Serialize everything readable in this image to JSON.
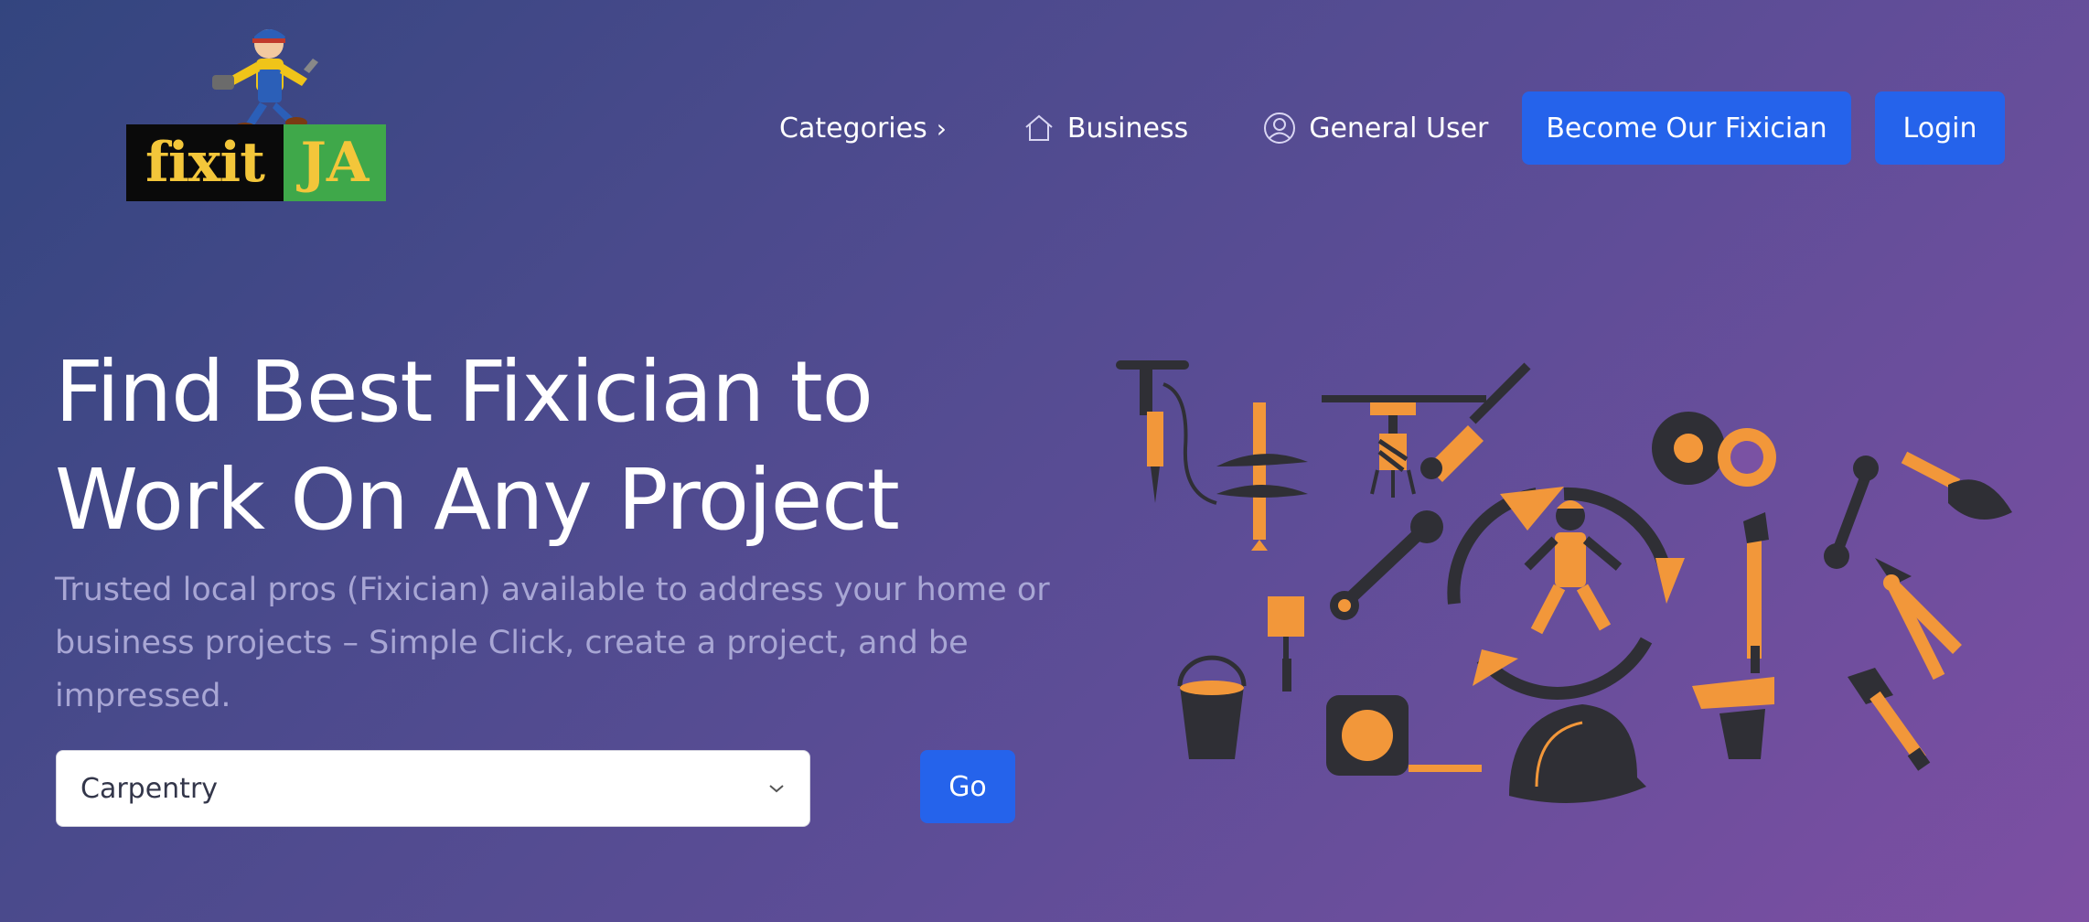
{
  "brand": {
    "logo_text_left": "fixit",
    "logo_text_right": "JA",
    "logo_colors": {
      "dark": "#0a0a0a",
      "green": "#3fa84a",
      "yellow": "#f3c63a"
    }
  },
  "nav": {
    "categories_label": "Categories",
    "categories_chevron": "›",
    "business_label": "Business",
    "business_icon": "home-icon",
    "general_user_label": "General User",
    "general_user_icon": "user-circle-icon"
  },
  "actions": {
    "become_label": "Become Our Fixician",
    "login_label": "Login",
    "accent": "#2563eb"
  },
  "hero": {
    "title_line1": "Find Best Fixician to",
    "title_line2": "Work On Any Project",
    "subtitle": "Trusted local pros (Fixician) available to address your home or business projects – Simple Click, create a project, and be impressed."
  },
  "search": {
    "selected_category": "Carpentry",
    "go_label": "Go"
  },
  "illustration": {
    "subject": "tools-and-worker-illustration",
    "colors": {
      "orange": "#f2973a",
      "dark": "#2f2f35"
    }
  }
}
